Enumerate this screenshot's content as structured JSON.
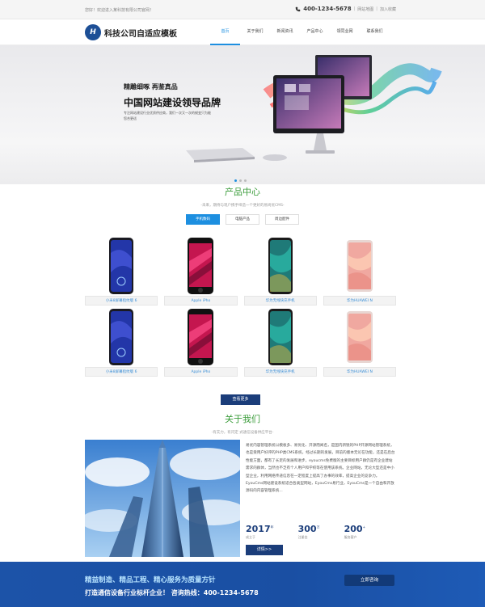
{
  "topbar": {
    "welcome": "您好！欢迎进入某科技有限公司官网！",
    "phone": "400-1234-5678",
    "sitemap": "网站地图",
    "favorite": "加入收藏"
  },
  "header": {
    "logo_mark": "H",
    "site_name": "科技公司自适应模板",
    "nav": [
      "首页",
      "关于我们",
      "新闻资讯",
      "产品中心",
      "领同业网",
      "联系我们"
    ]
  },
  "banner": {
    "kicker": "精雕细啄 再鉴真品",
    "headline": "中国网站建设领导品牌",
    "desc": "专注网站建设行业优质供应商，我们一次又一次的蜕变只为能您合更适"
  },
  "products": {
    "title": "产品中心",
    "subtitle": "-未来，期待与现户携手缔造一个更好的易尚优CMS-",
    "tabs": [
      "手机数码",
      "电脑产品",
      "周边配件"
    ],
    "items": [
      {
        "caption": "小米8屏幕指纹版 6"
      },
      {
        "caption": "Apple iPho"
      },
      {
        "caption": "华为无线快充手机"
      },
      {
        "caption": "华为HUAWEI N"
      },
      {
        "caption": "小米8屏幕指纹版 6"
      },
      {
        "caption": "Apple iPho"
      },
      {
        "caption": "华为无线快充手机"
      },
      {
        "caption": "华为HUAWEI N"
      }
    ],
    "more_label": "查看更多"
  },
  "about": {
    "title": "关于我们",
    "subtitle": "-有实力，有闪定 式通信设备供应平台-",
    "body": "易优内容管理系统以模板多、易优化、开源而闻名，是国内新锐的PHP开源网站管理系统，也是受用户好评的PHP类CMS系统，经过长期的发展，目前的版本无论在功能，还是在后台性能方面，都有了长足的发展和进步，eyoucms免费版的主要目标用户群仍是有企业建站需求的群体，当然也不乏有个人用户和学校等在使用该系统。企业网站，无论大型还是中小型企业，利用网络传递信息在一定程度上提高了办事的效率，提高企业的竞争力。EyouCms网站建设系统适合各类型网站，EyouCms易行业，EyouCms是一个自由和开放源码的内容管理系统...",
    "stats": [
      {
        "num": "2017",
        "unit": "年",
        "label": "成立于"
      },
      {
        "num": "300",
        "unit": "万",
        "label": "注册金"
      },
      {
        "num": "200",
        "unit": "+",
        "label": "服务客户"
      }
    ],
    "detail_label": "详情>>"
  },
  "cta": {
    "line1": "精益制造、精品工程、精心服务为质量方针",
    "line2": "打造通信设备行业标杆企业！  咨询热线：400-1234-5678",
    "button": "立即咨询"
  },
  "colors": {
    "accent": "#1d8fe0",
    "navy": "#1b3d7a",
    "green_title": "#3c9d3c",
    "cta_bg": "#1c53a8"
  }
}
